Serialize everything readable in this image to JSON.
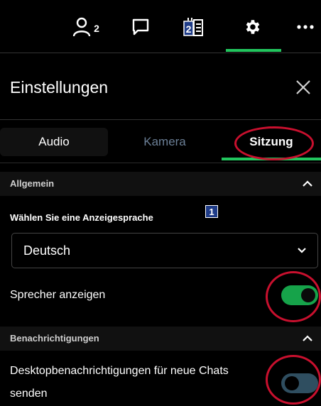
{
  "toolbar": {
    "participants_count": "2",
    "notes_badge": "2",
    "icons": [
      "person-icon",
      "chat-icon",
      "notes-icon",
      "gear-icon",
      "more-icon"
    ],
    "accent_color": "#22c55e"
  },
  "panel": {
    "title": "Einstellungen",
    "close_icon": "close-icon"
  },
  "tabs": [
    {
      "label": "Audio"
    },
    {
      "label": "Kamera"
    },
    {
      "label": "Sitzung",
      "active": true
    }
  ],
  "sections": {
    "general": {
      "title": "Allgemein",
      "language_label": "Wählen Sie eine Anzeigesprache",
      "language_badge": "1",
      "language_value": "Deutsch",
      "show_speaker_label": "Sprecher anzeigen",
      "show_speaker_on": true
    },
    "notifications": {
      "title": "Benachrichtigungen",
      "desktop_label_line1": "Desktopbenachrichtigungen für neue Chats",
      "desktop_label_line2": "senden",
      "desktop_on": false
    }
  },
  "colors": {
    "annotation": "#c8102e",
    "toggle_on": "#16a34a",
    "toggle_off": "#2f4e60"
  }
}
